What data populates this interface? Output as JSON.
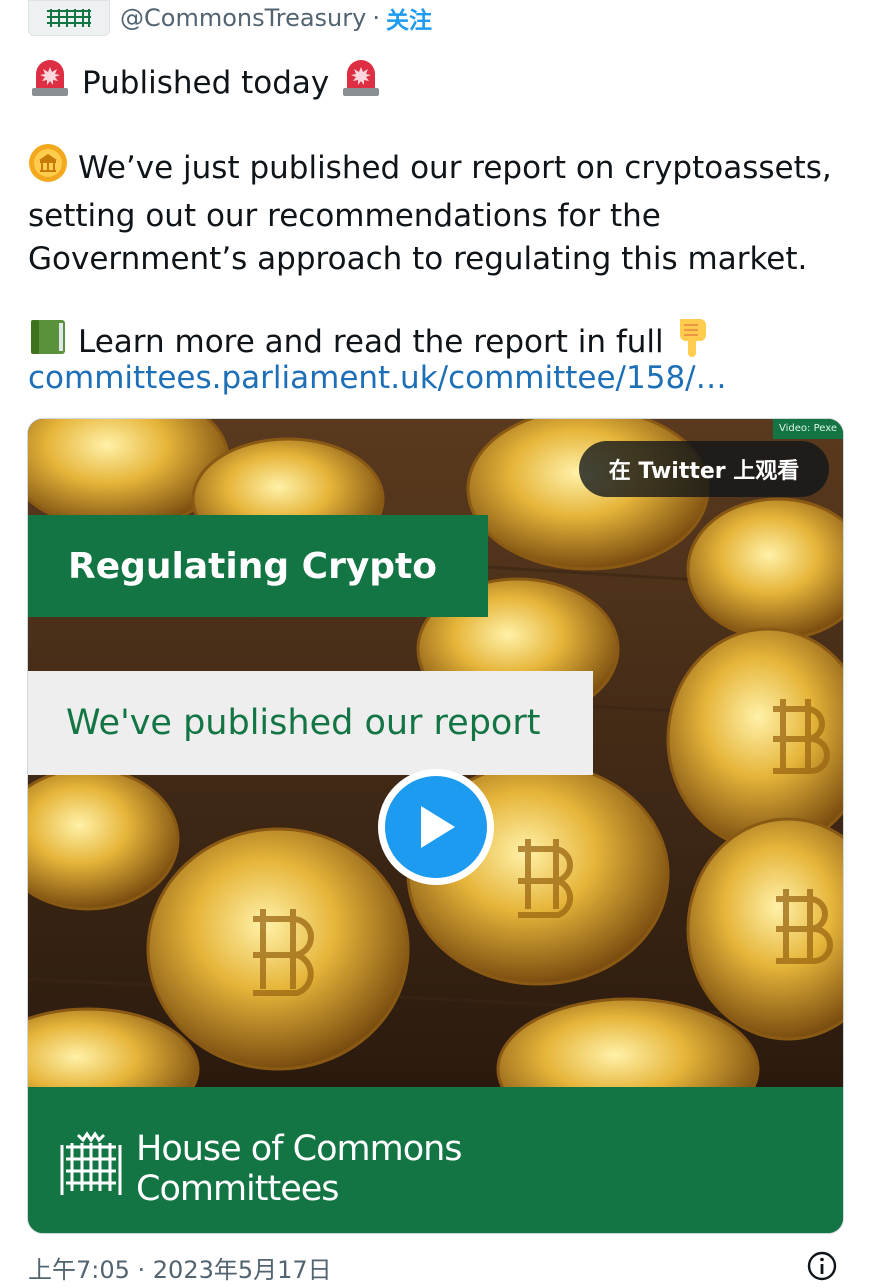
{
  "tweet": {
    "handle": "@CommonsTreasury",
    "separator": "·",
    "follow_label": "关注",
    "line1": "Published today",
    "para2": "We’ve just published our report on cryptoassets, setting out our recommendations for the Government’s approach to regulating this market.",
    "learn_more": "Learn more and read the report in full",
    "link_text": "committees.parliament.uk/committee/158/…",
    "timestamp": "上午7:05 · 2023年5月17日"
  },
  "media": {
    "watch_label": "在 Twitter 上观看",
    "credit": "Video: Pexe",
    "title_band": "Regulating Crypto",
    "subtitle_band": "We've published our report",
    "footer_line1": "House of Commons",
    "footer_line2": "Committees"
  },
  "icons": {
    "siren": "police-light-icon",
    "coin": "coin-icon",
    "book": "green-book-icon",
    "pointer": "backhand-index-down-icon",
    "play": "play-icon",
    "info": "info-icon",
    "portcullis": "portcullis-icon"
  },
  "colors": {
    "accent": "#1d9bf0",
    "link": "#1d6fb8",
    "brand_green": "#137544",
    "muted": "#536471"
  }
}
